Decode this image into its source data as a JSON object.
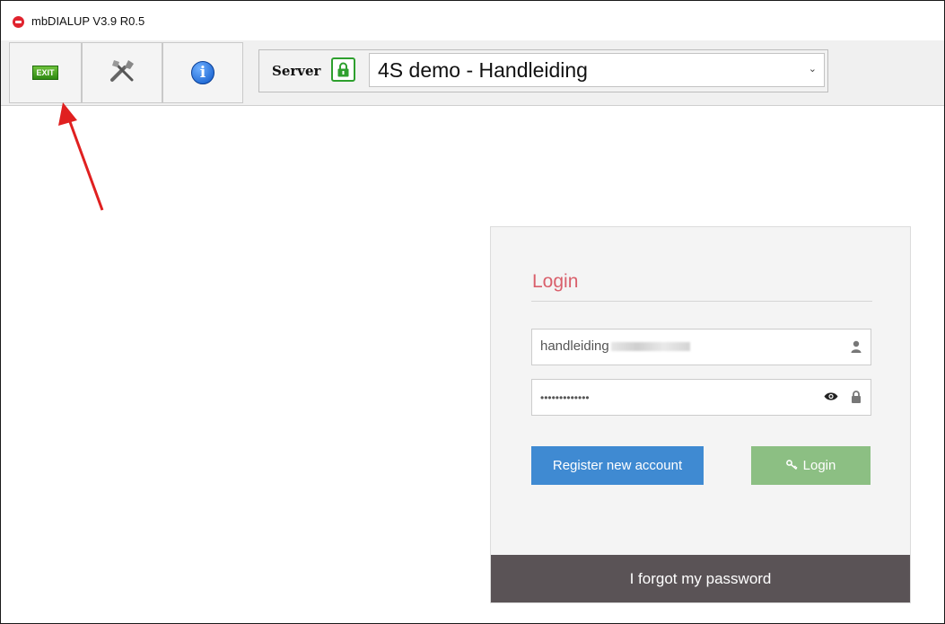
{
  "window": {
    "title": "mbDIALUP V3.9 R0.5",
    "app_icon": "mbdialup-logo-icon"
  },
  "toolbar": {
    "exit_label": "EXIT",
    "tools_icon": "tools-icon",
    "info_icon": "info-icon",
    "server_label": "Server",
    "server_lock_icon": "lock-icon",
    "server_value": "4S demo - Handleiding"
  },
  "login": {
    "title": "Login",
    "username_value": "handleiding",
    "username_icon": "user-icon",
    "password_value": "•••••••••••••",
    "show_password_icon": "eye-icon",
    "password_icon": "lock-icon",
    "register_label": "Register new account",
    "login_label": "Login",
    "login_icon": "key-icon",
    "forgot_label": "I forgot my password"
  },
  "colors": {
    "title_accent": "#d95f6b",
    "register_button": "#3f8ad2",
    "login_button": "#8cbf83",
    "forgot_bar": "#5a5356",
    "annotation_arrow": "#e02020"
  }
}
